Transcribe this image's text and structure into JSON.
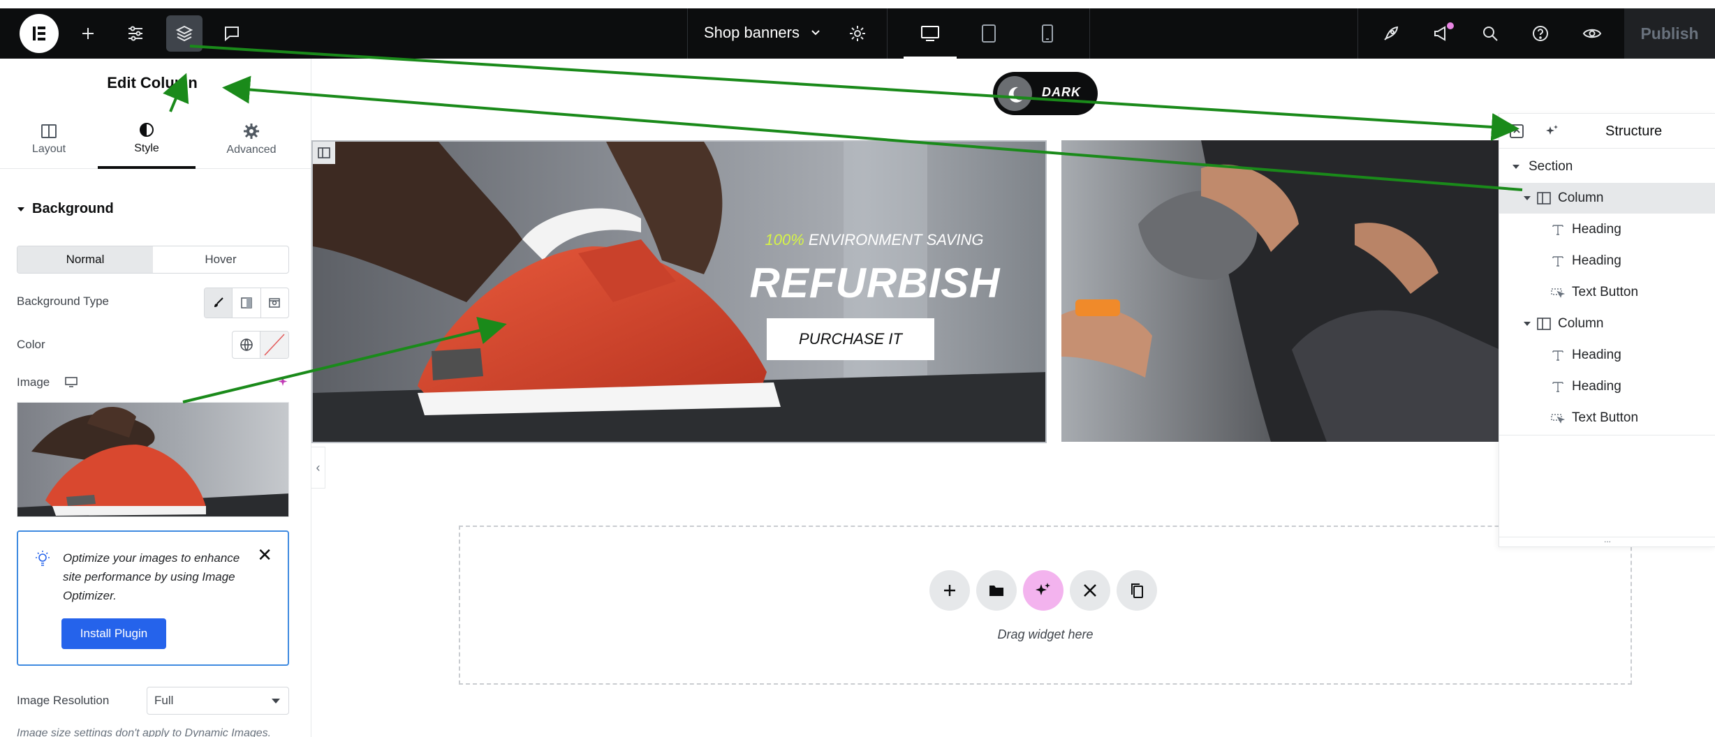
{
  "toolbar": {
    "document_title": "Shop banners",
    "publish_label": "Publish"
  },
  "panel": {
    "title": "Edit Column",
    "tabs": [
      {
        "label": "Layout"
      },
      {
        "label": "Style"
      },
      {
        "label": "Advanced"
      }
    ],
    "section_title": "Background",
    "state_tabs": {
      "normal": "Normal",
      "hover": "Hover"
    },
    "bg_type_label": "Background Type",
    "color_label": "Color",
    "image_label": "Image",
    "notice": {
      "text": "Optimize your images to enhance site performance by using Image Optimizer.",
      "button": "Install Plugin"
    },
    "resolution_label": "Image Resolution",
    "resolution_value": "Full",
    "hint": "Image size settings don't apply to Dynamic Images."
  },
  "canvas": {
    "dark_toggle_label": "DARK",
    "banner": {
      "sub_accent": "100%",
      "sub_rest": " ENVIRONMENT SAVING",
      "title": "REFURBISH",
      "button": "PURCHASE IT"
    },
    "dropzone_text": "Drag widget here"
  },
  "structure": {
    "title": "Structure",
    "items": [
      {
        "label": "Section"
      },
      {
        "label": "Column"
      },
      {
        "label": "Heading"
      },
      {
        "label": "Heading"
      },
      {
        "label": "Text Button"
      },
      {
        "label": "Column"
      },
      {
        "label": "Heading"
      },
      {
        "label": "Heading"
      },
      {
        "label": "Text Button"
      }
    ]
  },
  "colors": {
    "accent_blue": "#2563eb",
    "annotation_arrow": "#1a8a1a",
    "lime_accent": "#d7f545",
    "ai_pink": "#f3b3ee"
  }
}
